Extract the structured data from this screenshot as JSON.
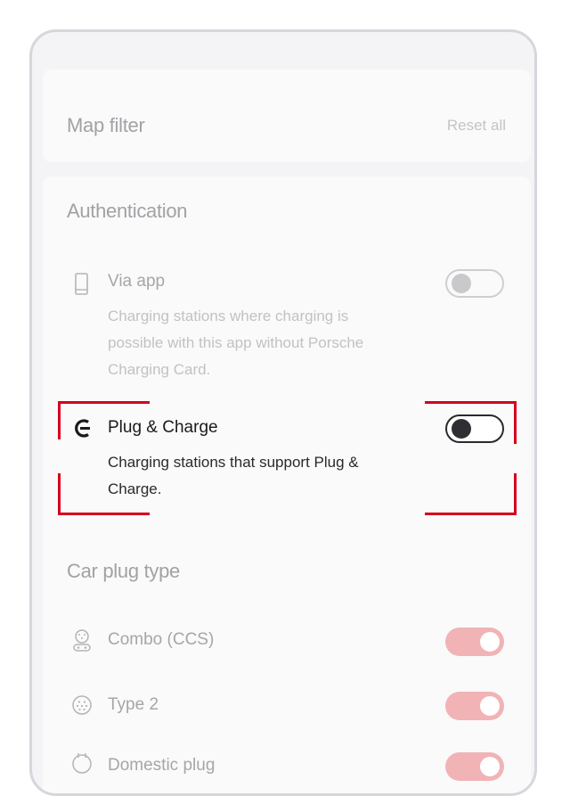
{
  "header": {
    "title": "Map filter",
    "reset_label": "Reset all"
  },
  "authentication": {
    "title": "Authentication",
    "items": [
      {
        "icon": "smartphone-icon",
        "title": "Via app",
        "description": "Charging stations where charging is possible with this app without Porsche Charging Card.",
        "toggle": "off",
        "state": "disabled"
      },
      {
        "icon": "plug-and-charge-icon",
        "title": "Plug & Charge",
        "description": "Charging stations that support Plug & Charge.",
        "toggle": "off",
        "state": "highlighted"
      }
    ]
  },
  "car_plug_type": {
    "title": "Car plug type",
    "items": [
      {
        "icon": "ccs-connector-icon",
        "title": "Combo (CCS)",
        "toggle": "on"
      },
      {
        "icon": "type2-connector-icon",
        "title": "Type 2",
        "toggle": "on"
      },
      {
        "icon": "domestic-plug-icon",
        "title": "Domestic plug",
        "toggle": "on"
      }
    ]
  },
  "colors": {
    "accent": "#d5001c",
    "toggle_on_faded": "#f1b3b6"
  }
}
